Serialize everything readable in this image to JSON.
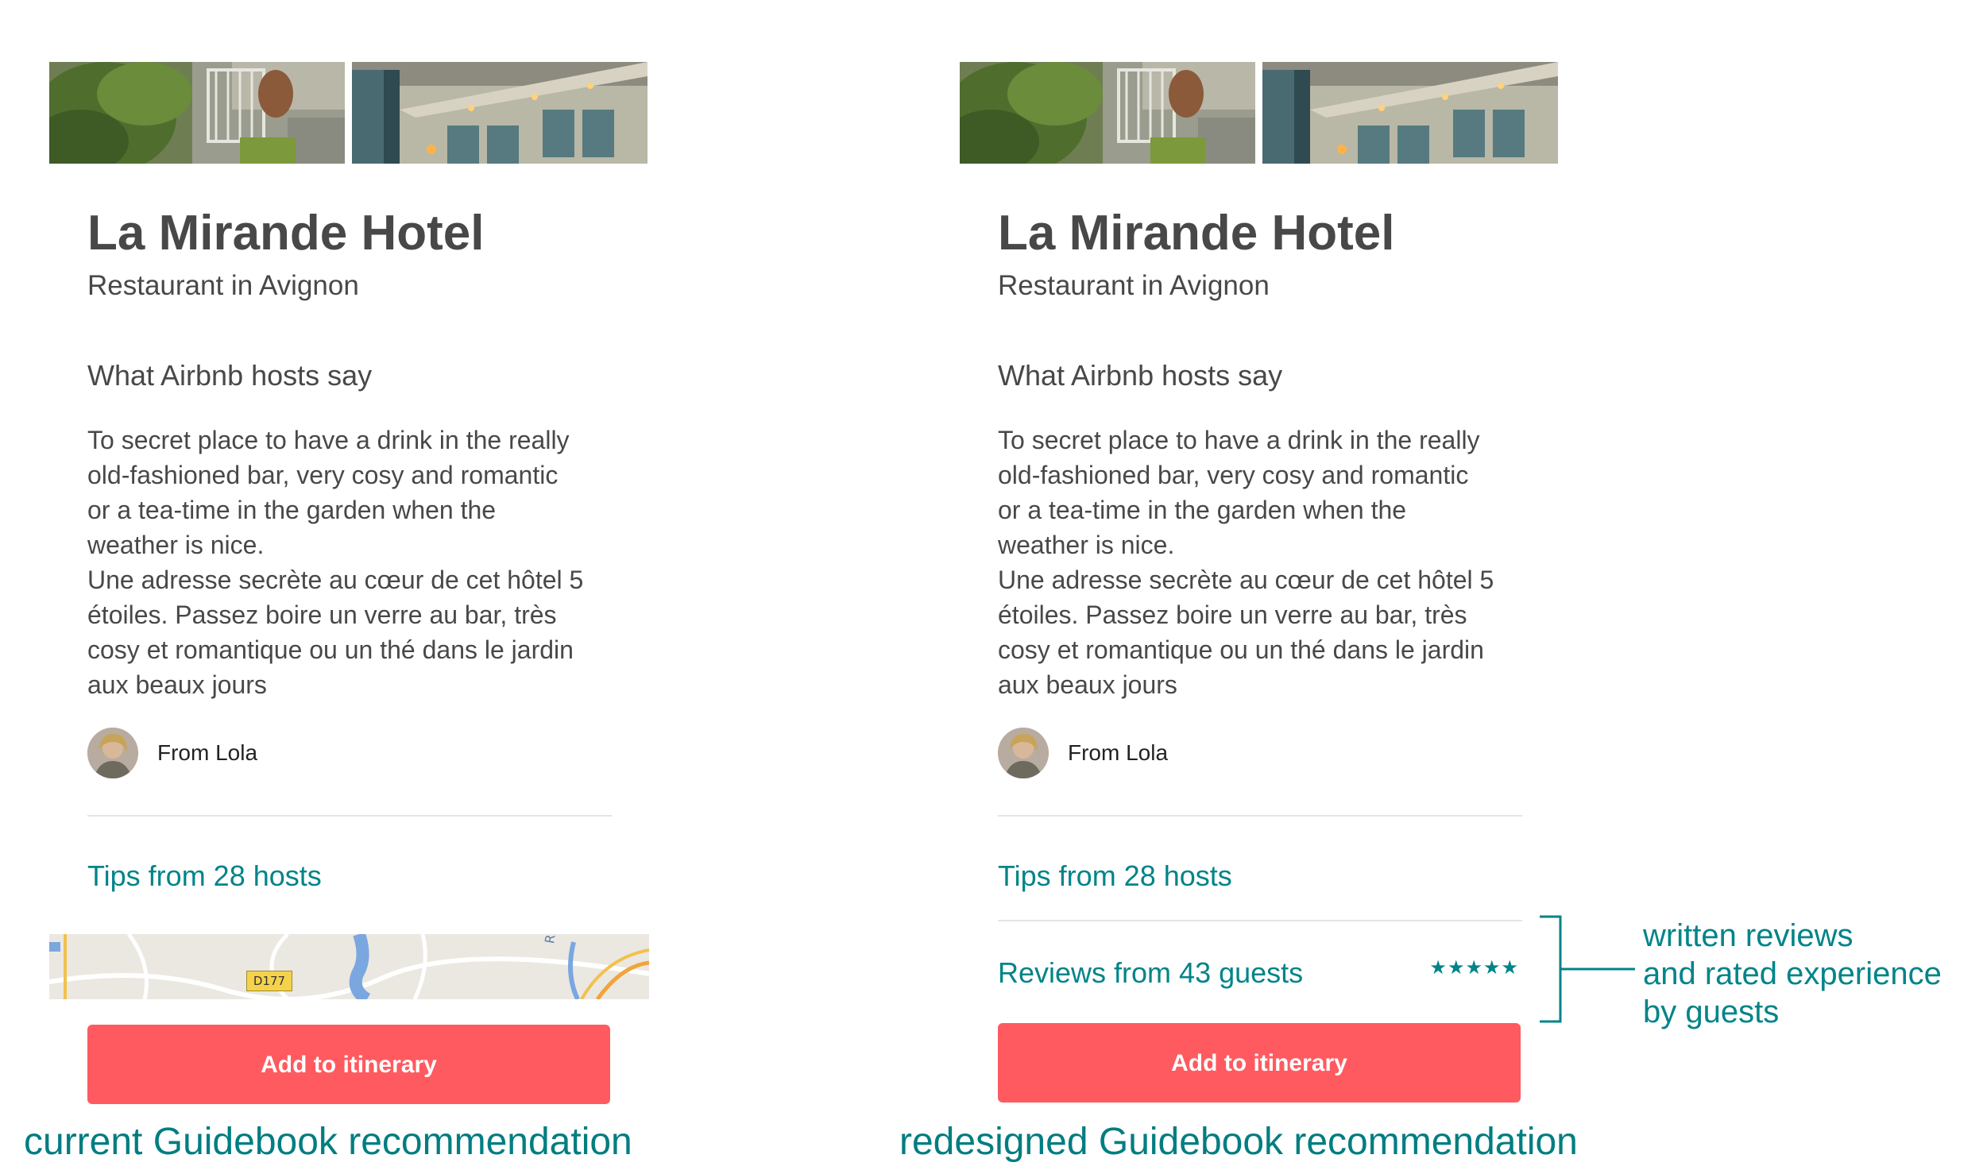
{
  "current": {
    "title": "La Mirande Hotel",
    "subtitle": "Restaurant in Avignon",
    "section_heading": "What Airbnb hosts say",
    "description_lines": [
      "To secret place to have a drink in the really",
      "old-fashioned bar, very cosy and romantic",
      "or a tea-time in the garden when the",
      "weather is nice.",
      "Une adresse secrète au cœur de cet hôtel 5",
      "étoiles. Passez boire un verre au bar, très",
      "cosy et romantique ou un thé dans le jardin",
      "aux beaux jours"
    ],
    "author": "From Lola",
    "tips_link": "Tips from 28 hosts",
    "map": {
      "road_label": "D177",
      "river_label": "Rhône"
    },
    "button_label": "Add to itinerary",
    "caption": "current Guidebook recommendation"
  },
  "redesigned": {
    "title": "La Mirande Hotel",
    "subtitle": "Restaurant in Avignon",
    "section_heading": "What Airbnb hosts say",
    "description_lines": [
      "To secret place to have a drink in the really",
      "old-fashioned bar, very cosy and romantic",
      "or a tea-time in the garden when the",
      "weather is nice.",
      "Une adresse secrète au cœur de cet hôtel 5",
      "étoiles. Passez boire un verre au bar, très",
      "cosy et romantique ou un thé dans le jardin",
      "aux beaux jours"
    ],
    "author": "From Lola",
    "tips_link": "Tips from 28 hosts",
    "reviews_link": "Reviews from 43 guests",
    "rating_stars": "★★★★★",
    "button_label": "Add to itinerary",
    "caption": "redesigned Guidebook recommendation"
  },
  "annotation_lines": [
    "written reviews",
    "and rated experience",
    "by guests"
  ],
  "colors": {
    "accent_teal": "#008489",
    "button_coral": "#ff5a5f",
    "text_dark": "#484848"
  },
  "icons": [
    "avatar-photo",
    "star-icon"
  ]
}
